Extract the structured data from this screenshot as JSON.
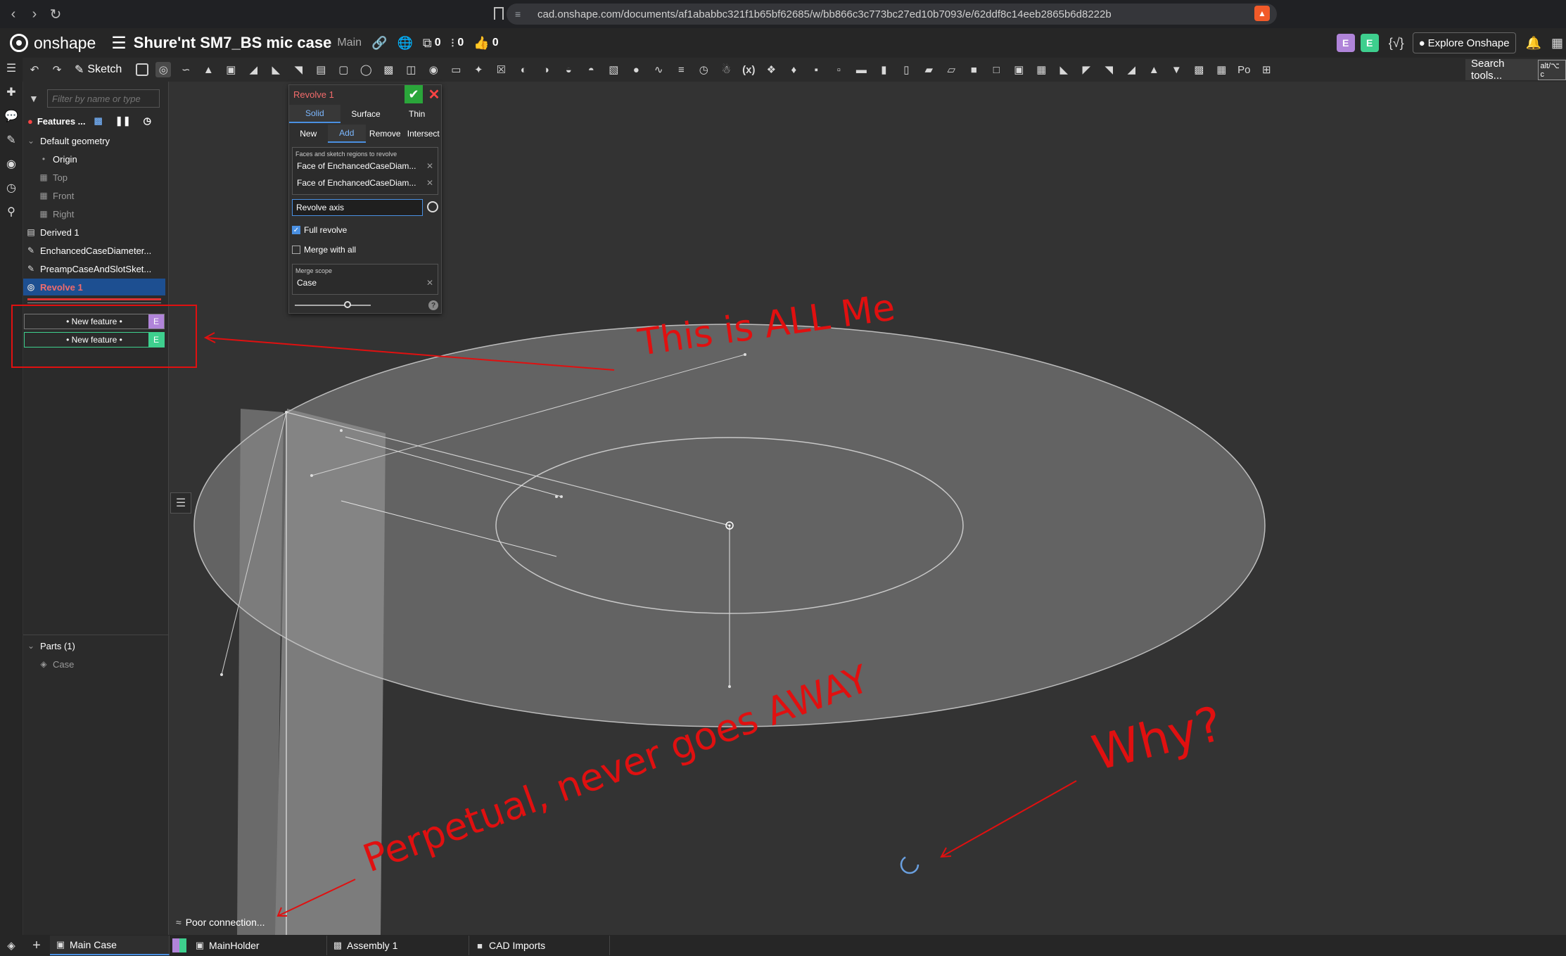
{
  "browser": {
    "url": "cad.onshape.com/documents/af1ababbc321f1b65bf62685/w/bb866c3c773bc27ed10b7093/e/62ddf8c14eeb2865b6d8222b"
  },
  "header": {
    "app_name": "onshape",
    "doc_title": "Shure'nt SM7_BS mic case",
    "branch": "Main",
    "versions_count": "0",
    "branches_count": "0",
    "likes_count": "0",
    "avatar_1": "E",
    "avatar_2": "E",
    "variable_label": "{✓}",
    "explore_label": "Explore Onshape"
  },
  "toolbar": {
    "sketch_label": "Sketch",
    "variable_label": "(x)",
    "search_label": "Search tools...",
    "search_shortcut": "alt/⌥ c",
    "po_label": "Po"
  },
  "feature_panel": {
    "filter_placeholder": "Filter by name or type",
    "features_label": "Features ...",
    "default_geometry": "Default geometry",
    "origin": "Origin",
    "top": "Top",
    "front": "Front",
    "right": "Right",
    "derived": "Derived 1",
    "sketch1": "EnchancedCaseDiameter...",
    "sketch2": "PreampCaseAndSlotSket...",
    "revolve": "Revolve 1",
    "new_feature_1": "• New feature •",
    "new_feature_2": "• New feature •",
    "badge": "E",
    "parts_label": "Parts (1)",
    "part_case": "Case"
  },
  "dialog": {
    "title": "Revolve 1",
    "tabs": [
      "Solid",
      "Surface",
      "Thin"
    ],
    "ops": [
      "New",
      "Add",
      "Remove",
      "Intersect"
    ],
    "faces_label": "Faces and sketch regions to revolve",
    "face_1": "Face of EnchancedCaseDiam...",
    "face_2": "Face of EnchancedCaseDiam...",
    "axis_placeholder": "Revolve axis",
    "full_revolve": "Full revolve",
    "merge_all": "Merge with all",
    "merge_scope_label": "Merge scope",
    "merge_scope_value": "Case",
    "help": "?"
  },
  "annotations": {
    "text_1": "This is ALL Me",
    "text_2": "Perpetual, never goes AWAY",
    "text_3": "Why?"
  },
  "status": {
    "poor_connection": "Poor connection..."
  },
  "bottom_tabs": [
    "Main Case",
    "MainHolder",
    "Assembly 1",
    "CAD Imports"
  ],
  "colors": {
    "accent": "#4a90e2",
    "annotation": "#e01010",
    "badge_purple": "#b084d9",
    "badge_green": "#3ecf8e",
    "revolve_red": "#f26b6b",
    "confirm_green": "#2aa63a"
  }
}
